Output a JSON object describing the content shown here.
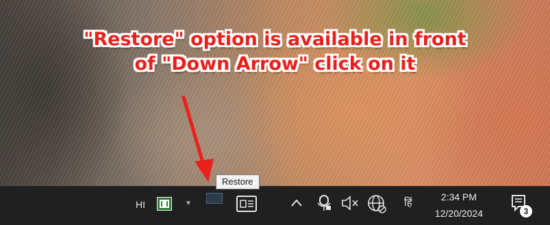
{
  "annotation": {
    "line1": "\"Restore\" option is available in front",
    "line2": "of \"Down Arrow\"  click on it",
    "text_color": "#e8211d",
    "outline_color": "#ffffff",
    "arrow_color": "#e8211d"
  },
  "tooltip": {
    "text": "Restore"
  },
  "taskbar": {
    "background": "#202020",
    "language": "HI",
    "icons": {
      "ime": "ime-indicator-icon",
      "dropdown": "down-arrow-icon",
      "restore": "restore-window-icon",
      "task_view": "task-view-icon",
      "show_hidden": "chevron-up-icon",
      "mic": "camera-mic-icon",
      "volume": "speaker-muted-icon",
      "network": "globe-network-icon",
      "hindi_input": "hindi-input-icon",
      "notifications": "notification-center-icon"
    },
    "hindi_label": "हिं",
    "clock": {
      "time": "2:34 PM",
      "date": "12/20/2024"
    },
    "notification_count": "3"
  }
}
